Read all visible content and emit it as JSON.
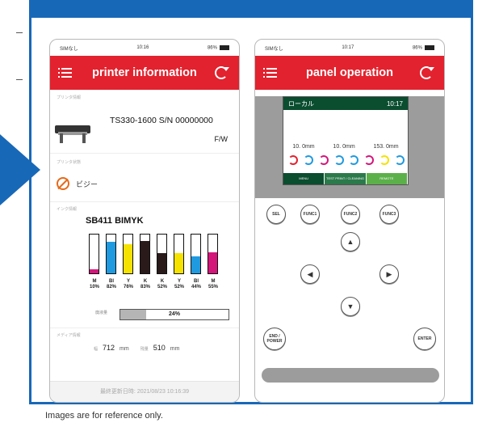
{
  "caption": "Images are for reference only.",
  "colors": {
    "accent": "#1868b8",
    "appbar": "#e2222e"
  },
  "left_phone": {
    "status": {
      "carrier": "SIMなし",
      "time": "10:16",
      "battery": "86%"
    },
    "title": "printer information",
    "sections": {
      "printer": "プリンタ情報",
      "status": "プリンタ状態",
      "ink": "インク情報",
      "media": "メディア情報"
    },
    "printer_model": "TS330-1600  S/N  00000000",
    "printer_fw": "F/W",
    "buzzer_text": "ビジー",
    "ink_set": "SB411  BIMYK",
    "inks": [
      {
        "name": "M",
        "percent": "10%",
        "level": 0.1,
        "color": "#d4167a"
      },
      {
        "name": "Bl",
        "percent": "82%",
        "level": 0.82,
        "color": "#1f9ae0"
      },
      {
        "name": "Y",
        "percent": "76%",
        "level": 0.76,
        "color": "#f5e200"
      },
      {
        "name": "K",
        "percent": "83%",
        "level": 0.83,
        "color": "#2a1a1a"
      },
      {
        "name": "K",
        "percent": "52%",
        "level": 0.52,
        "color": "#2a1a1a"
      },
      {
        "name": "Y",
        "percent": "52%",
        "level": 0.52,
        "color": "#f5e200"
      },
      {
        "name": "Bl",
        "percent": "44%",
        "level": 0.44,
        "color": "#1f9ae0"
      },
      {
        "name": "M",
        "percent": "55%",
        "level": 0.55,
        "color": "#d4167a"
      }
    ],
    "waste": {
      "label": "廃液量",
      "percent": "24%",
      "level": 0.24
    },
    "media": {
      "width_label": "幅",
      "width_value": "712",
      "width_unit": "mm",
      "length_label": "残量",
      "length_value": "510",
      "length_unit": "mm"
    },
    "footer": "最終更新日時: 2021/08/23 10:16:39"
  },
  "right_phone": {
    "status": {
      "carrier": "SIMなし",
      "time": "10:17",
      "battery": "86%"
    },
    "title": "panel operation",
    "lcd": {
      "mode": "ローカル",
      "time": "10:17",
      "values": [
        "10. 0mm",
        "10. 0mm",
        "153. 0mm"
      ],
      "ink_colors": [
        "#e2222e",
        "#1f9ae0",
        "#d4167a",
        "#1f9ae0",
        "#1f9ae0",
        "#d4167a",
        "#f5e200",
        "#1f9ae0"
      ],
      "fn_labels": [
        "MENU",
        "TEST PRINT / CLEANING",
        "REMOTE"
      ]
    },
    "buttons": {
      "sel": "SEL",
      "func1": "FUNC1",
      "func2": "FUNC2",
      "func3": "FUNC3",
      "up": "▲",
      "left": "◀",
      "right": "▶",
      "down": "▼",
      "end_power": "END / POWER",
      "enter": "ENTER"
    }
  }
}
